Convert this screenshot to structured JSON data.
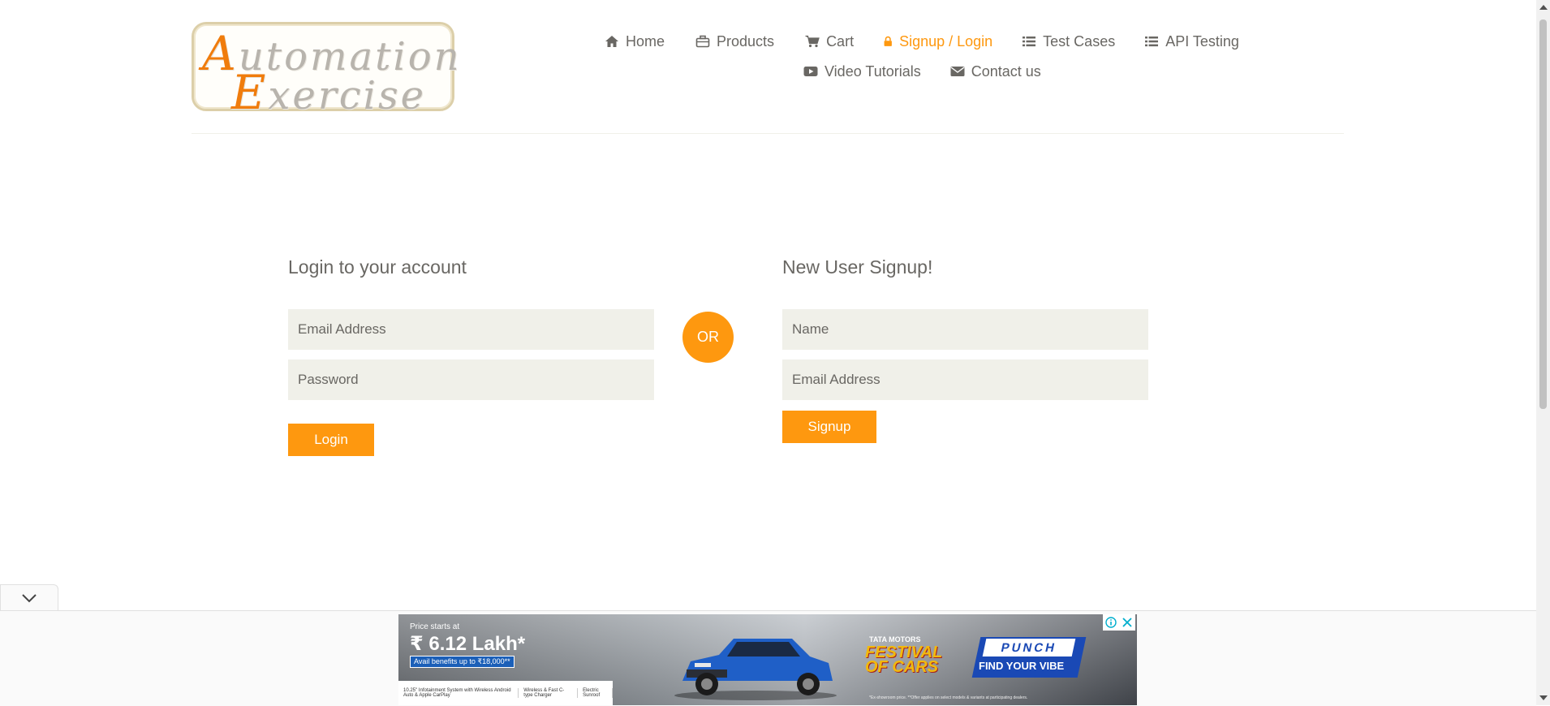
{
  "header": {
    "logo": {
      "line1_cap": "A",
      "line1_rest": "utomation",
      "line2_cap": "E",
      "line2_rest": "xercise"
    },
    "nav": [
      {
        "label": "Home",
        "icon": "home-icon"
      },
      {
        "label": "Products",
        "icon": "briefcase-icon"
      },
      {
        "label": "Cart",
        "icon": "cart-icon"
      },
      {
        "label": "Signup / Login",
        "icon": "lock-icon",
        "active": true
      },
      {
        "label": "Test Cases",
        "icon": "list-icon"
      },
      {
        "label": "API Testing",
        "icon": "list-icon"
      },
      {
        "label": "Video Tutorials",
        "icon": "youtube-play-icon"
      },
      {
        "label": "Contact us",
        "icon": "envelope-icon"
      }
    ]
  },
  "login": {
    "title": "Login to your account",
    "email_placeholder": "Email Address",
    "password_placeholder": "Password",
    "button": "Login"
  },
  "or_label": "OR",
  "signup": {
    "title": "New User Signup!",
    "name_placeholder": "Name",
    "email_placeholder": "Email Address",
    "button": "Signup"
  },
  "ad": {
    "price_caption": "Price starts at",
    "price": "₹ 6.12 Lakh*",
    "benefit": "Avail benefits up to ₹18,000**",
    "features": [
      "10.25\" Infotainment System with Wireless Android Auto & Apple CarPlay",
      "Wireless & Fast C-type Charger",
      "Electric Sunroof"
    ],
    "brand": "TATA MOTORS",
    "festival_line1": "FESTIVAL",
    "festival_line2": "OF CARS",
    "model": "PUNCH",
    "tagline": "FIND YOUR VIBE",
    "disclaimer": "*Ex-showroom price. **Offer applies on select models & variants at participating dealers."
  },
  "colors": {
    "accent": "#fe980f",
    "text": "#696763",
    "field_bg": "#f0f0e9"
  }
}
